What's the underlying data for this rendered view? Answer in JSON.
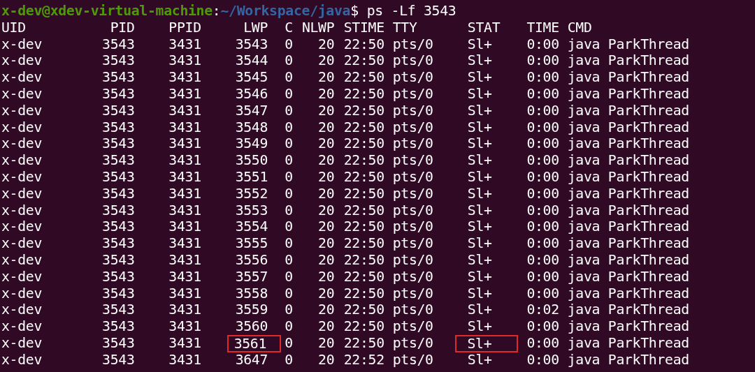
{
  "prompt": {
    "user_host": "x-dev@xdev-virtual-machine",
    "separator": ":",
    "path": "~/Workspace/java",
    "symbol": "$",
    "command": "ps -Lf 3543"
  },
  "columns": [
    "UID",
    "PID",
    "PPID",
    "LWP",
    "C",
    "NLWP",
    "STIME",
    "TTY",
    "STAT",
    "TIME",
    "CMD"
  ],
  "rows": [
    {
      "cells": [
        "x-dev",
        "3543",
        "3431",
        "3543",
        "0",
        "20",
        "22:50",
        "pts/0",
        "Sl+",
        "0:00",
        "java ParkThread"
      ],
      "lwp_boxed": false,
      "stat_boxed": false
    },
    {
      "cells": [
        "x-dev",
        "3543",
        "3431",
        "3544",
        "0",
        "20",
        "22:50",
        "pts/0",
        "Sl+",
        "0:00",
        "java ParkThread"
      ],
      "lwp_boxed": false,
      "stat_boxed": false
    },
    {
      "cells": [
        "x-dev",
        "3543",
        "3431",
        "3545",
        "0",
        "20",
        "22:50",
        "pts/0",
        "Sl+",
        "0:00",
        "java ParkThread"
      ],
      "lwp_boxed": false,
      "stat_boxed": false
    },
    {
      "cells": [
        "x-dev",
        "3543",
        "3431",
        "3546",
        "0",
        "20",
        "22:50",
        "pts/0",
        "Sl+",
        "0:00",
        "java ParkThread"
      ],
      "lwp_boxed": false,
      "stat_boxed": false
    },
    {
      "cells": [
        "x-dev",
        "3543",
        "3431",
        "3547",
        "0",
        "20",
        "22:50",
        "pts/0",
        "Sl+",
        "0:00",
        "java ParkThread"
      ],
      "lwp_boxed": false,
      "stat_boxed": false
    },
    {
      "cells": [
        "x-dev",
        "3543",
        "3431",
        "3548",
        "0",
        "20",
        "22:50",
        "pts/0",
        "Sl+",
        "0:00",
        "java ParkThread"
      ],
      "lwp_boxed": false,
      "stat_boxed": false
    },
    {
      "cells": [
        "x-dev",
        "3543",
        "3431",
        "3549",
        "0",
        "20",
        "22:50",
        "pts/0",
        "Sl+",
        "0:00",
        "java ParkThread"
      ],
      "lwp_boxed": false,
      "stat_boxed": false
    },
    {
      "cells": [
        "x-dev",
        "3543",
        "3431",
        "3550",
        "0",
        "20",
        "22:50",
        "pts/0",
        "Sl+",
        "0:00",
        "java ParkThread"
      ],
      "lwp_boxed": false,
      "stat_boxed": false
    },
    {
      "cells": [
        "x-dev",
        "3543",
        "3431",
        "3551",
        "0",
        "20",
        "22:50",
        "pts/0",
        "Sl+",
        "0:00",
        "java ParkThread"
      ],
      "lwp_boxed": false,
      "stat_boxed": false
    },
    {
      "cells": [
        "x-dev",
        "3543",
        "3431",
        "3552",
        "0",
        "20",
        "22:50",
        "pts/0",
        "Sl+",
        "0:00",
        "java ParkThread"
      ],
      "lwp_boxed": false,
      "stat_boxed": false
    },
    {
      "cells": [
        "x-dev",
        "3543",
        "3431",
        "3553",
        "0",
        "20",
        "22:50",
        "pts/0",
        "Sl+",
        "0:00",
        "java ParkThread"
      ],
      "lwp_boxed": false,
      "stat_boxed": false
    },
    {
      "cells": [
        "x-dev",
        "3543",
        "3431",
        "3554",
        "0",
        "20",
        "22:50",
        "pts/0",
        "Sl+",
        "0:00",
        "java ParkThread"
      ],
      "lwp_boxed": false,
      "stat_boxed": false
    },
    {
      "cells": [
        "x-dev",
        "3543",
        "3431",
        "3555",
        "0",
        "20",
        "22:50",
        "pts/0",
        "Sl+",
        "0:00",
        "java ParkThread"
      ],
      "lwp_boxed": false,
      "stat_boxed": false
    },
    {
      "cells": [
        "x-dev",
        "3543",
        "3431",
        "3556",
        "0",
        "20",
        "22:50",
        "pts/0",
        "Sl+",
        "0:00",
        "java ParkThread"
      ],
      "lwp_boxed": false,
      "stat_boxed": false
    },
    {
      "cells": [
        "x-dev",
        "3543",
        "3431",
        "3557",
        "0",
        "20",
        "22:50",
        "pts/0",
        "Sl+",
        "0:00",
        "java ParkThread"
      ],
      "lwp_boxed": false,
      "stat_boxed": false
    },
    {
      "cells": [
        "x-dev",
        "3543",
        "3431",
        "3558",
        "0",
        "20",
        "22:50",
        "pts/0",
        "Sl+",
        "0:00",
        "java ParkThread"
      ],
      "lwp_boxed": false,
      "stat_boxed": false
    },
    {
      "cells": [
        "x-dev",
        "3543",
        "3431",
        "3559",
        "0",
        "20",
        "22:50",
        "pts/0",
        "Sl+",
        "0:02",
        "java ParkThread"
      ],
      "lwp_boxed": false,
      "stat_boxed": false
    },
    {
      "cells": [
        "x-dev",
        "3543",
        "3431",
        "3560",
        "0",
        "20",
        "22:50",
        "pts/0",
        "Sl+",
        "0:00",
        "java ParkThread"
      ],
      "lwp_boxed": false,
      "stat_boxed": false
    },
    {
      "cells": [
        "x-dev",
        "3543",
        "3431",
        "3561",
        "0",
        "20",
        "22:50",
        "pts/0",
        "Sl+",
        "0:00",
        "java ParkThread"
      ],
      "lwp_boxed": true,
      "stat_boxed": true
    },
    {
      "cells": [
        "x-dev",
        "3543",
        "3431",
        "3647",
        "0",
        "20",
        "22:52",
        "pts/0",
        "Sl+",
        "0:00",
        "java ParkThread"
      ],
      "lwp_boxed": false,
      "stat_boxed": false
    }
  ]
}
